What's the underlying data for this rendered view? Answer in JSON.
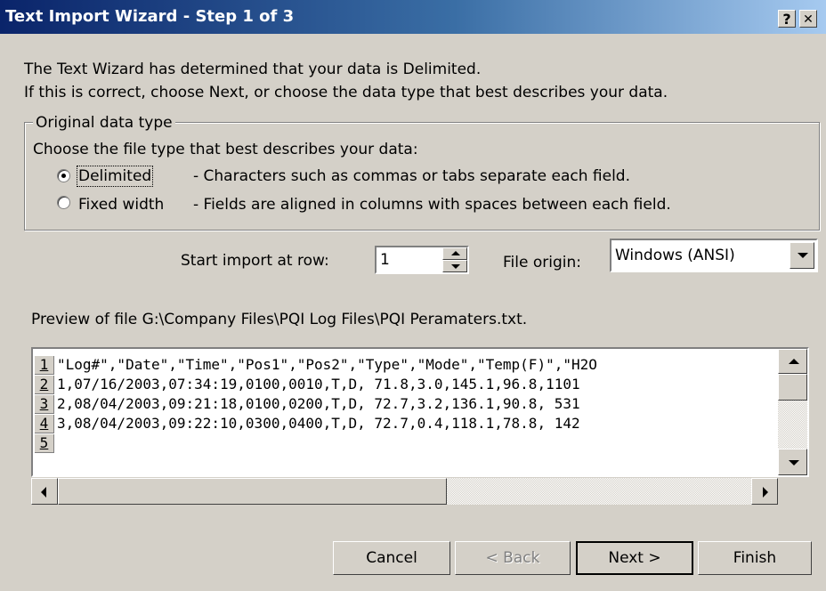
{
  "window": {
    "title": "Text Import Wizard - Step 1 of 3",
    "help_button": "?",
    "close_button": "✕"
  },
  "intro": {
    "line1": "The Text Wizard has determined that your data is Delimited.",
    "line2": "If this is correct, choose Next, or choose the data type that best describes your data."
  },
  "data_type": {
    "legend": "Original data type",
    "prompt": "Choose the file type that best describes your data:",
    "options": [
      {
        "label": "Delimited",
        "description": "- Characters such as commas or tabs separate each field.",
        "selected": true
      },
      {
        "label": "Fixed width",
        "description": "- Fields are aligned in columns with spaces between each field.",
        "selected": false
      }
    ]
  },
  "start_row": {
    "label": "Start import at row:",
    "value": "1"
  },
  "file_origin": {
    "label": "File origin:",
    "value": "Windows (ANSI)"
  },
  "preview": {
    "label": "Preview of file G:\\Company Files\\PQI Log Files\\PQI Peramaters.txt.",
    "rows": [
      {
        "num": "1",
        "text": "\"Log#\",\"Date\",\"Time\",\"Pos1\",\"Pos2\",\"Type\",\"Mode\",\"Temp(F)\",\"H2O"
      },
      {
        "num": "2",
        "text": "1,07/16/2003,07:34:19,0100,0010,T,D, 71.8,3.0,145.1,96.8,1101"
      },
      {
        "num": "3",
        "text": "2,08/04/2003,09:21:18,0100,0200,T,D, 72.7,3.2,136.1,90.8, 531"
      },
      {
        "num": "4",
        "text": "3,08/04/2003,09:22:10,0300,0400,T,D, 72.7,0.4,118.1,78.8, 142"
      },
      {
        "num": "5",
        "text": ""
      }
    ]
  },
  "buttons": {
    "cancel": "Cancel",
    "back": "< Back",
    "next": "Next >",
    "finish": "Finish"
  }
}
